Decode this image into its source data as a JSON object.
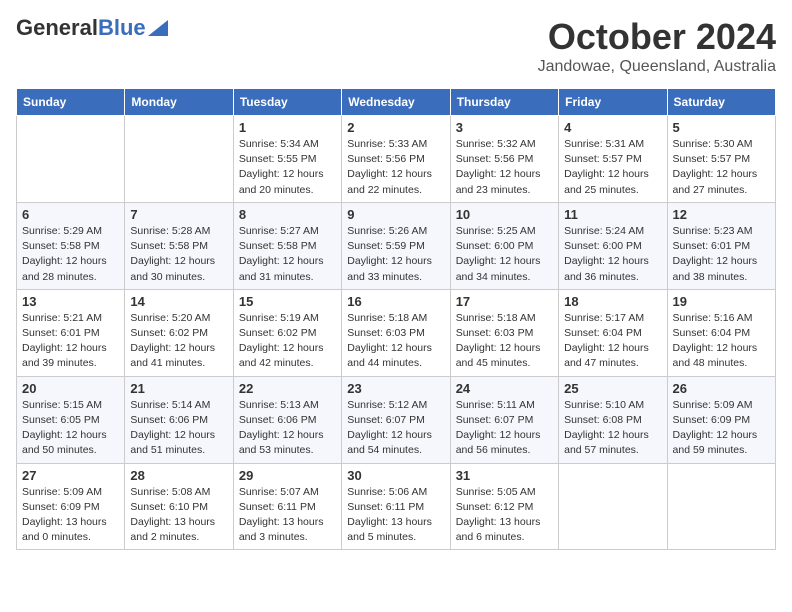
{
  "header": {
    "logo_general": "General",
    "logo_blue": "Blue",
    "month_title": "October 2024",
    "location": "Jandowae, Queensland, Australia"
  },
  "days_of_week": [
    "Sunday",
    "Monday",
    "Tuesday",
    "Wednesday",
    "Thursday",
    "Friday",
    "Saturday"
  ],
  "weeks": [
    [
      {
        "day": "",
        "info": ""
      },
      {
        "day": "",
        "info": ""
      },
      {
        "day": "1",
        "info": "Sunrise: 5:34 AM\nSunset: 5:55 PM\nDaylight: 12 hours\nand 20 minutes."
      },
      {
        "day": "2",
        "info": "Sunrise: 5:33 AM\nSunset: 5:56 PM\nDaylight: 12 hours\nand 22 minutes."
      },
      {
        "day": "3",
        "info": "Sunrise: 5:32 AM\nSunset: 5:56 PM\nDaylight: 12 hours\nand 23 minutes."
      },
      {
        "day": "4",
        "info": "Sunrise: 5:31 AM\nSunset: 5:57 PM\nDaylight: 12 hours\nand 25 minutes."
      },
      {
        "day": "5",
        "info": "Sunrise: 5:30 AM\nSunset: 5:57 PM\nDaylight: 12 hours\nand 27 minutes."
      }
    ],
    [
      {
        "day": "6",
        "info": "Sunrise: 5:29 AM\nSunset: 5:58 PM\nDaylight: 12 hours\nand 28 minutes."
      },
      {
        "day": "7",
        "info": "Sunrise: 5:28 AM\nSunset: 5:58 PM\nDaylight: 12 hours\nand 30 minutes."
      },
      {
        "day": "8",
        "info": "Sunrise: 5:27 AM\nSunset: 5:58 PM\nDaylight: 12 hours\nand 31 minutes."
      },
      {
        "day": "9",
        "info": "Sunrise: 5:26 AM\nSunset: 5:59 PM\nDaylight: 12 hours\nand 33 minutes."
      },
      {
        "day": "10",
        "info": "Sunrise: 5:25 AM\nSunset: 6:00 PM\nDaylight: 12 hours\nand 34 minutes."
      },
      {
        "day": "11",
        "info": "Sunrise: 5:24 AM\nSunset: 6:00 PM\nDaylight: 12 hours\nand 36 minutes."
      },
      {
        "day": "12",
        "info": "Sunrise: 5:23 AM\nSunset: 6:01 PM\nDaylight: 12 hours\nand 38 minutes."
      }
    ],
    [
      {
        "day": "13",
        "info": "Sunrise: 5:21 AM\nSunset: 6:01 PM\nDaylight: 12 hours\nand 39 minutes."
      },
      {
        "day": "14",
        "info": "Sunrise: 5:20 AM\nSunset: 6:02 PM\nDaylight: 12 hours\nand 41 minutes."
      },
      {
        "day": "15",
        "info": "Sunrise: 5:19 AM\nSunset: 6:02 PM\nDaylight: 12 hours\nand 42 minutes."
      },
      {
        "day": "16",
        "info": "Sunrise: 5:18 AM\nSunset: 6:03 PM\nDaylight: 12 hours\nand 44 minutes."
      },
      {
        "day": "17",
        "info": "Sunrise: 5:18 AM\nSunset: 6:03 PM\nDaylight: 12 hours\nand 45 minutes."
      },
      {
        "day": "18",
        "info": "Sunrise: 5:17 AM\nSunset: 6:04 PM\nDaylight: 12 hours\nand 47 minutes."
      },
      {
        "day": "19",
        "info": "Sunrise: 5:16 AM\nSunset: 6:04 PM\nDaylight: 12 hours\nand 48 minutes."
      }
    ],
    [
      {
        "day": "20",
        "info": "Sunrise: 5:15 AM\nSunset: 6:05 PM\nDaylight: 12 hours\nand 50 minutes."
      },
      {
        "day": "21",
        "info": "Sunrise: 5:14 AM\nSunset: 6:06 PM\nDaylight: 12 hours\nand 51 minutes."
      },
      {
        "day": "22",
        "info": "Sunrise: 5:13 AM\nSunset: 6:06 PM\nDaylight: 12 hours\nand 53 minutes."
      },
      {
        "day": "23",
        "info": "Sunrise: 5:12 AM\nSunset: 6:07 PM\nDaylight: 12 hours\nand 54 minutes."
      },
      {
        "day": "24",
        "info": "Sunrise: 5:11 AM\nSunset: 6:07 PM\nDaylight: 12 hours\nand 56 minutes."
      },
      {
        "day": "25",
        "info": "Sunrise: 5:10 AM\nSunset: 6:08 PM\nDaylight: 12 hours\nand 57 minutes."
      },
      {
        "day": "26",
        "info": "Sunrise: 5:09 AM\nSunset: 6:09 PM\nDaylight: 12 hours\nand 59 minutes."
      }
    ],
    [
      {
        "day": "27",
        "info": "Sunrise: 5:09 AM\nSunset: 6:09 PM\nDaylight: 13 hours\nand 0 minutes."
      },
      {
        "day": "28",
        "info": "Sunrise: 5:08 AM\nSunset: 6:10 PM\nDaylight: 13 hours\nand 2 minutes."
      },
      {
        "day": "29",
        "info": "Sunrise: 5:07 AM\nSunset: 6:11 PM\nDaylight: 13 hours\nand 3 minutes."
      },
      {
        "day": "30",
        "info": "Sunrise: 5:06 AM\nSunset: 6:11 PM\nDaylight: 13 hours\nand 5 minutes."
      },
      {
        "day": "31",
        "info": "Sunrise: 5:05 AM\nSunset: 6:12 PM\nDaylight: 13 hours\nand 6 minutes."
      },
      {
        "day": "",
        "info": ""
      },
      {
        "day": "",
        "info": ""
      }
    ]
  ]
}
